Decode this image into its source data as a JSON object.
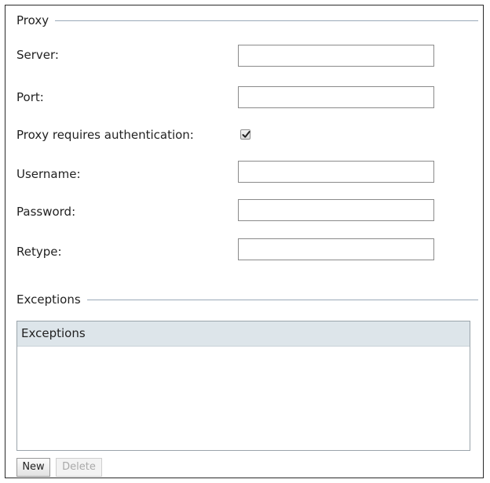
{
  "proxy": {
    "legend": "Proxy",
    "server_label": "Server:",
    "server_value": "",
    "port_label": "Port:",
    "port_value": "",
    "auth_label": "Proxy requires authentication:",
    "auth_checked": true,
    "username_label": "Username:",
    "username_value": "",
    "password_label": "Password:",
    "password_value": "",
    "retype_label": "Retype:",
    "retype_value": ""
  },
  "exceptions": {
    "legend": "Exceptions",
    "column_header": "Exceptions",
    "rows": []
  },
  "buttons": {
    "new_label": "New",
    "delete_label": "Delete",
    "delete_enabled": false
  },
  "icons": {
    "checkbox_mark": "checkmark-icon"
  },
  "colors": {
    "border": "#2a2a2a",
    "legend_line": "#9aaab8",
    "table_header_bg": "#dde5ea",
    "input_border": "#8a8a8a"
  }
}
